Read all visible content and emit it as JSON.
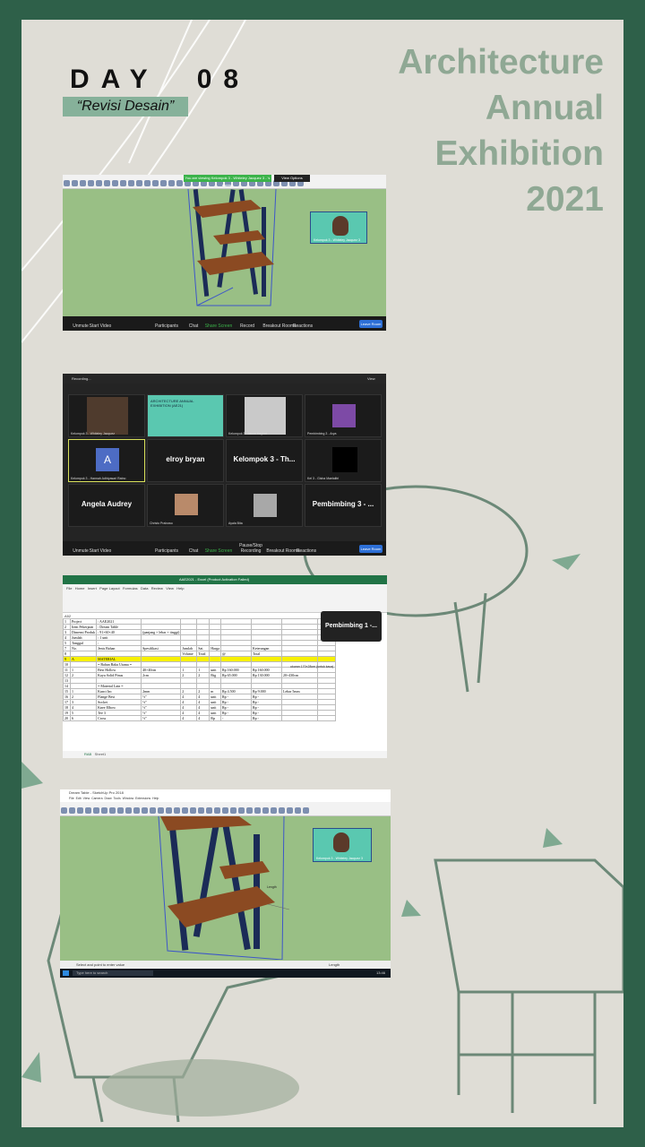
{
  "poster": {
    "day": "DAY  08",
    "subtitle": "“Revisi Desain”",
    "headline": [
      "Architecture",
      "Annual",
      "Exhibition",
      "2021"
    ],
    "colors": {
      "frame": "#2e6049",
      "background": "#dfddd6",
      "accent": "#86b19a",
      "headline": "#8fa894"
    }
  },
  "screenshot_1": {
    "app": "SketchUp",
    "share_banner": "You are viewing Kelompok 3 - Whiteley Jacquez 3 - 's screen",
    "view_options": "View Options",
    "camera_label": "Kelompok 3 - Whiteley Jacquez 3",
    "toolbar": [
      "Unmute",
      "Start Video",
      "Participants",
      "Chat",
      "Share Screen",
      "Record",
      "Breakout Rooms",
      "Reactions"
    ],
    "end_button": "Leave Room"
  },
  "screenshot_2": {
    "recording": "Recording...",
    "view_label": "View",
    "tiles": [
      {
        "name": "",
        "tag": "Kelompok 3 - Whiteley Jacquez"
      },
      {
        "name": "",
        "tag": "",
        "slide_title": "ARCHITECTURE ANNUAL EXHIBITION (AE21)"
      },
      {
        "name": "",
        "tag": "Kelompok 3 - Jason Haykal"
      },
      {
        "name": "",
        "tag": "Pembimbing 3 - Arya"
      },
      {
        "name": "",
        "tag": "Kelompok 3 - Hannah Adhtyasari Ratno",
        "avatar": "A"
      },
      {
        "name": "elroy bryan",
        "tag": ""
      },
      {
        "name": "Kelompok 3 - Th...",
        "tag": ""
      },
      {
        "name": "",
        "tag": "Kel 3 - Gisha Maelalitri"
      },
      {
        "name": "Angela Audrey",
        "tag": ""
      },
      {
        "name": "",
        "tag": "Christo Prabowo"
      },
      {
        "name": "",
        "tag": "Ayala Bita"
      },
      {
        "name": "Pembimbing 3 - ...",
        "tag": ""
      }
    ],
    "toolbar": [
      "Unmute",
      "Start Video",
      "Participants",
      "Chat",
      "Share Screen",
      "Pause/Stop Recording",
      "Breakout Rooms",
      "Reactions"
    ],
    "end_button": "Leave Room"
  },
  "screenshot_3": {
    "app_title": "AAE2021 - Excel (Product Activation Failed)",
    "menu": [
      "File",
      "Home",
      "Insert",
      "Page Layout",
      "Formulas",
      "Data",
      "Review",
      "View",
      "Help"
    ],
    "cell_ref": "A52",
    "popup": "Pembimbing 1 -...",
    "rows": [
      [
        "1",
        "Project",
        ": AAE2021",
        "",
        "",
        "",
        "",
        "",
        "",
        "",
        ""
      ],
      [
        "2",
        "Item Pekerjaan",
        ": Dream Table",
        "",
        "",
        "",
        "",
        "",
        "",
        "",
        ""
      ],
      [
        "3",
        "Dimensi Produk",
        ": 91×60×40",
        "(panjang × lebar × tinggi)",
        "",
        "",
        "",
        "",
        "",
        "",
        ""
      ],
      [
        "4",
        "Jumlah",
        ": 1 unit",
        "",
        "",
        "",
        "",
        "",
        "",
        "",
        ""
      ],
      [
        "5",
        "Tanggal",
        ":",
        "",
        "",
        "",
        "",
        "",
        "",
        "",
        ""
      ],
      [
        "7",
        "No.",
        "Jenis Bahan",
        "Spesifikasi",
        "Jumlah",
        "Sat.",
        "Harga",
        "",
        "Keterangan",
        "",
        ""
      ],
      [
        "8",
        "",
        "",
        "",
        "Volume",
        "Total",
        "",
        "@",
        "Total",
        "",
        ""
      ],
      [
        "9",
        "A",
        "MATERIAL",
        "",
        "",
        "",
        "",
        "",
        "",
        "",
        ""
      ],
      [
        "10",
        "",
        "= Bahan Baku Utama =",
        "",
        "",
        "",
        "",
        "",
        "",
        "",
        ""
      ],
      [
        "11",
        "1",
        "Besi Hollow",
        "40×40cm",
        "1",
        "1",
        "unit",
        "Rp 160.000",
        "Rp 160.000",
        "",
        ""
      ],
      [
        "12",
        "2",
        "Kayu Solid Pinus",
        "2cm",
        "2",
        "2",
        "Btg",
        "Rp 65.000",
        "Rp 130.000",
        "20×430cm",
        ""
      ],
      [
        "13",
        "",
        "",
        "",
        "",
        "",
        "",
        "",
        "",
        "",
        ""
      ],
      [
        "14",
        "",
        "= Material Lain =",
        "",
        "",
        "",
        "",
        "",
        "",
        "",
        ""
      ],
      [
        "15",
        "1",
        "Kunci Inc",
        "2mm",
        "2",
        "2",
        "m",
        "Rp 4.500",
        "Rp 9.000",
        "Lebar 5mm",
        ""
      ],
      [
        "16",
        "2",
        "Flange Besi",
        "½\"",
        "4",
        "4",
        "unit",
        "Rp -",
        "Rp -",
        "",
        ""
      ],
      [
        "17",
        "3",
        "Socket",
        "½\"",
        "4",
        "4",
        "unit",
        "Rp -",
        "Rp -",
        "",
        ""
      ],
      [
        "18",
        "4",
        "Knee Elbow",
        "½\"",
        "4",
        "4",
        "unit",
        "Rp -",
        "Rp -",
        "",
        ""
      ],
      [
        "19",
        "5",
        "Tee 3",
        "½\"",
        "4",
        "4",
        "unit",
        "Rp -",
        "Rp -",
        "",
        ""
      ],
      [
        "20",
        "6",
        "Cross",
        "½\"",
        "4",
        "4",
        "Rp",
        "-",
        "Rp -",
        "",
        ""
      ]
    ],
    "side_note": "ukuran 170×28cm (untuk kaca)",
    "sheet_tabs": [
      "RAB",
      "Sheet1"
    ]
  },
  "screenshot_4": {
    "app_title": "Dream Table - SketchUp Pro 2018",
    "menu": [
      "File",
      "Edit",
      "View",
      "Camera",
      "Draw",
      "Tools",
      "Window",
      "Extensions",
      "Help"
    ],
    "camera_label": "Kelompok 3 - Whiteley Jacquez 3",
    "measure_tip": "Length",
    "status": "Select and point to enter value",
    "length_label": "Length",
    "search": "Type here to search",
    "clock": "13:46"
  }
}
